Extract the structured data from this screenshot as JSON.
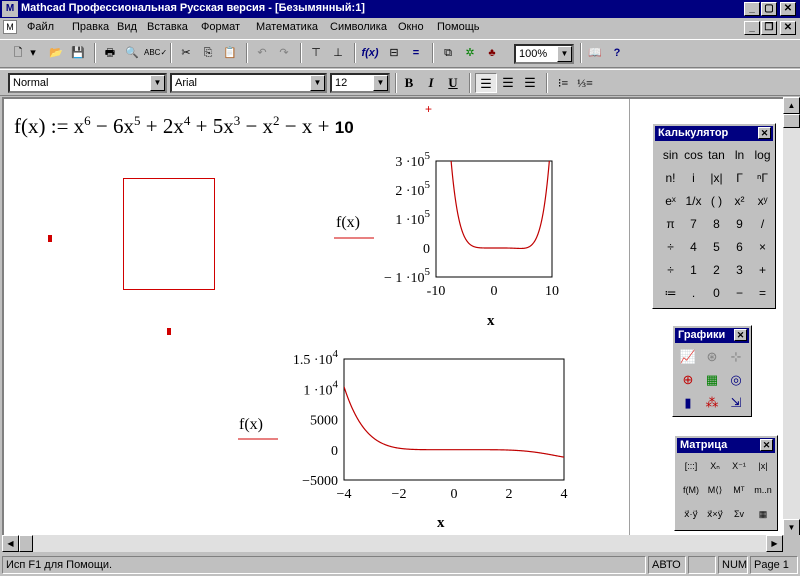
{
  "window": {
    "title": "Mathcad Профессиональная Русская версия - [Безымянный:1]"
  },
  "menu": [
    "Файл",
    "Правка",
    "Вид",
    "Вставка",
    "Формат",
    "Математика",
    "Символика",
    "Окно",
    "Помощь"
  ],
  "toolbar": {
    "zoom": "100%",
    "fx_label": "f(x)",
    "equals_label": "="
  },
  "format_toolbar": {
    "style": "Normal",
    "font": "Arial",
    "size": "12",
    "bold": "B",
    "italic": "I",
    "underline": "U"
  },
  "worksheet": {
    "formula": {
      "lhs": "f(x) := x",
      "p1": "6",
      "t2": " − 6x",
      "p2": "5",
      "t3": " + 2x",
      "p3": "4",
      "t4": " + 5x",
      "p4": "3",
      "t5": " − x",
      "p5": "2",
      "t6": " − x + ",
      "const": "10"
    }
  },
  "chart_data": [
    {
      "type": "line",
      "function": "x^6 - 6x^5 + 2x^4 + 5x^3 - x^2 - x + 10",
      "xlabel": "x",
      "ylabel": "f(x)",
      "xlim": [
        -10,
        10
      ],
      "ylim": [
        -100000,
        300000
      ],
      "xticks": [
        "-10",
        "0",
        "10"
      ],
      "yticks": [
        {
          "mant": "3 ·10",
          "exp": "5"
        },
        {
          "mant": "2 ·10",
          "exp": "5"
        },
        {
          "mant": "1 ·10",
          "exp": "5"
        },
        {
          "mant": "0",
          "exp": ""
        },
        {
          "mant": "− 1 ·10",
          "exp": "5"
        }
      ],
      "color": "#c00000"
    },
    {
      "type": "line",
      "function": "x^6 - 6x^5 + 2x^4 + 5x^3 - x^2 - x + 10",
      "xlabel": "x",
      "ylabel": "f(x)",
      "xlim": [
        -4,
        4
      ],
      "ylim": [
        -5000,
        15000
      ],
      "xticks": [
        "−4",
        "−2",
        "0",
        "2",
        "4"
      ],
      "yticks": [
        {
          "mant": "1.5 ·10",
          "exp": "4"
        },
        {
          "mant": "1 ·10",
          "exp": "4"
        },
        {
          "mant": "5000",
          "exp": ""
        },
        {
          "mant": "0",
          "exp": ""
        },
        {
          "mant": "−5000",
          "exp": ""
        }
      ],
      "color": "#c00000"
    }
  ],
  "calculator": {
    "title": "Калькулятор",
    "keys": [
      [
        "sin",
        "cos",
        "tan",
        "ln",
        "log"
      ],
      [
        "n!",
        "i",
        "|x|",
        "Γ",
        "ⁿΓ"
      ],
      [
        "eˣ",
        "1/x",
        "( )",
        "x²",
        "xʸ"
      ],
      [
        "π",
        "7",
        "8",
        "9",
        "/"
      ],
      [
        "÷",
        "4",
        "5",
        "6",
        "×"
      ],
      [
        "÷",
        "1",
        "2",
        "3",
        "+"
      ],
      [
        "≔",
        ".",
        "0",
        "−",
        "="
      ]
    ]
  },
  "graphs": {
    "title": "Графики"
  },
  "matrix": {
    "title": "Матрица",
    "keys": [
      [
        "[:::]",
        "Xₙ",
        "X⁻¹",
        "|x|"
      ],
      [
        "f(M)",
        "M⟨⟩",
        "Mᵀ",
        "m..n"
      ],
      [
        "x⃗·y⃗",
        "x⃗×y⃗",
        "Σv",
        "▦"
      ]
    ]
  },
  "status": {
    "help": "Исп F1 для Помощи.",
    "mode": "АВТО",
    "blank": "",
    "num": "NUM",
    "page": "Page 1"
  }
}
